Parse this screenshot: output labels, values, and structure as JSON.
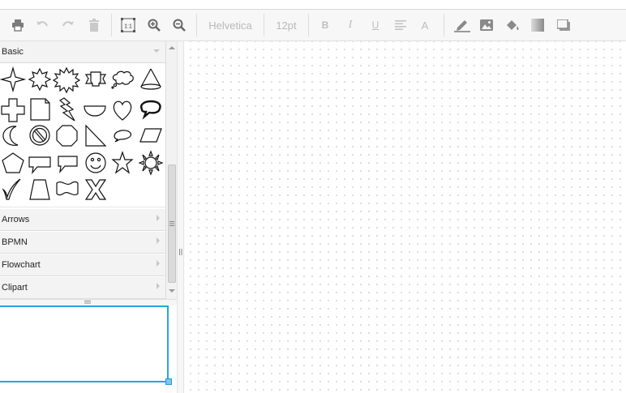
{
  "toolbar": {
    "font_family": "Helvetica",
    "font_size": "12pt",
    "icons": [
      "print-icon",
      "undo-icon",
      "redo-icon",
      "delete-icon",
      "actual-size-icon",
      "zoom-in-icon",
      "zoom-out-icon",
      "bold-icon",
      "italic-icon",
      "underline-icon",
      "align-icon",
      "font-color-icon",
      "line-color-icon",
      "image-icon",
      "fill-color-icon",
      "gradient-icon",
      "shadow-icon"
    ],
    "actual_size_label": "1:1",
    "bold_label": "B",
    "italic_label": "I",
    "underline_label": "U",
    "font_color_label": "A"
  },
  "sidebar": {
    "sections": [
      {
        "label": "Basic",
        "expanded": true
      },
      {
        "label": "Arrows",
        "expanded": false
      },
      {
        "label": "BPMN",
        "expanded": false
      },
      {
        "label": "Flowchart",
        "expanded": false
      },
      {
        "label": "Clipart",
        "expanded": false
      }
    ],
    "basic_shapes": [
      "4-point-star",
      "8-point-star",
      "12-point-star",
      "banner",
      "cloud-callout",
      "cone",
      "cross",
      "folded-corner",
      "lightning",
      "half-circle",
      "heart",
      "loud-callout",
      "moon",
      "no-symbol",
      "octagon",
      "right-triangle",
      "oval-callout",
      "parallelogram",
      "pentagon",
      "rectangular-callout",
      "rounded-callout",
      "smiley",
      "star",
      "sun",
      "tick",
      "trapezoid",
      "wave",
      "x-shape"
    ]
  },
  "colors": {
    "accent": "#29a3e0",
    "toolbar_bg": "#f7f7f7",
    "grid_dot": "#d6d6d6"
  }
}
